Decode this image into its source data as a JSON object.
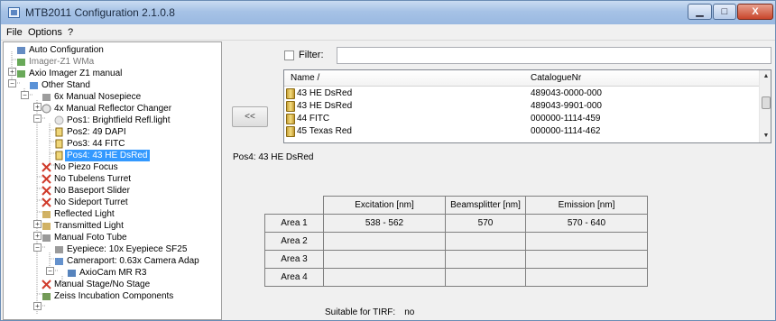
{
  "window": {
    "title": "MTB2011 Configuration 2.1.0.8",
    "minimize_glyph": "▁",
    "maximize_glyph": "□",
    "close_glyph": "X"
  },
  "menu": [
    "File",
    "Options",
    "?"
  ],
  "tree": [
    {
      "label": "Auto Configuration",
      "icon": "auto-config-icon"
    },
    {
      "label": "Imager-Z1 WMa",
      "icon": "microscope-icon",
      "gray": true
    },
    {
      "label": "Axio Imager Z1 manual",
      "icon": "microscope-icon"
    },
    {
      "label": "Other Stand",
      "icon": "stand-icon"
    },
    {
      "label": "6x Manual Nosepiece",
      "icon": "nosepiece-icon"
    },
    {
      "label": "4x Manual Reflector Changer",
      "icon": "reflector-changer-icon"
    },
    {
      "label": "Pos1: Brightfield Refl.light",
      "icon": "position-icon"
    },
    {
      "label": "Pos2: 49 DAPI",
      "icon": "filter-cube-icon"
    },
    {
      "label": "Pos3: 44 FITC",
      "icon": "filter-cube-icon"
    },
    {
      "label": "Pos4: 43 HE DsRed",
      "icon": "filter-cube-icon",
      "selected": true
    },
    {
      "label": "No Piezo Focus",
      "icon": "none-icon"
    },
    {
      "label": "No Tubelens Turret",
      "icon": "none-icon"
    },
    {
      "label": "No Baseport Slider",
      "icon": "none-icon"
    },
    {
      "label": "No Sideport Turret",
      "icon": "none-icon"
    },
    {
      "label": "Reflected Light",
      "icon": "reflected-light-icon"
    },
    {
      "label": "Transmitted Light",
      "icon": "transmitted-light-icon"
    },
    {
      "label": "Manual Foto Tube",
      "icon": "foto-tube-icon"
    },
    {
      "label": "Eyepiece: 10x Eyepiece SF25",
      "icon": "eyepiece-icon"
    },
    {
      "label": "Cameraport: 0.63x Camera Adap",
      "icon": "cameraport-icon"
    },
    {
      "label": "AxioCam MR R3",
      "icon": "camera-icon"
    },
    {
      "label": "Manual Stage/No Stage",
      "icon": "stage-icon"
    },
    {
      "label": "Zeiss Incubation Components",
      "icon": "incubation-icon"
    }
  ],
  "filter": {
    "label": "Filter:",
    "value": ""
  },
  "list": {
    "headers": {
      "name": "Name  /",
      "catalogue": "CatalogueNr"
    },
    "rows": [
      {
        "name": "43 HE DsRed",
        "catalogue": "489043-0000-000"
      },
      {
        "name": "43 HE DsRed",
        "catalogue": "489043-9901-000"
      },
      {
        "name": "44 FITC",
        "catalogue": "000000-1114-459"
      },
      {
        "name": "45 Texas Red",
        "catalogue": "000000-1114-462"
      }
    ],
    "scroll_up_glyph": "▲",
    "scroll_down_glyph": "▼"
  },
  "back_button": "<<",
  "position_label": "Pos4: 43 HE DsRed",
  "table": {
    "headers": [
      "Excitation [nm]",
      "Beamsplitter [nm]",
      "Emission [nm]"
    ],
    "rows": [
      {
        "area": "Area 1",
        "excitation": "538 - 562",
        "beamsplitter": "570",
        "emission": "570 - 640"
      },
      {
        "area": "Area 2",
        "excitation": "",
        "beamsplitter": "",
        "emission": ""
      },
      {
        "area": "Area 3",
        "excitation": "",
        "beamsplitter": "",
        "emission": ""
      },
      {
        "area": "Area 4",
        "excitation": "",
        "beamsplitter": "",
        "emission": ""
      }
    ]
  },
  "tirf": {
    "label": "Suitable for TIRF:",
    "value": "no"
  }
}
